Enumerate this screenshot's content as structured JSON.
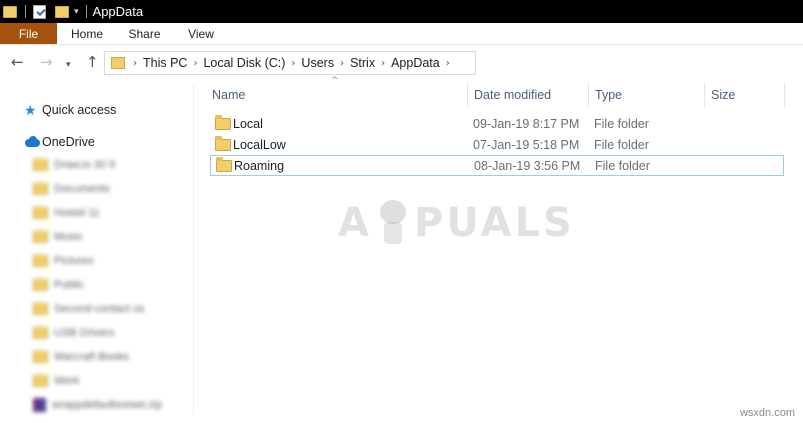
{
  "window": {
    "title": "AppData"
  },
  "ribbon": {
    "tabs": [
      "File",
      "Home",
      "Share",
      "View"
    ]
  },
  "address_bar": {
    "crumbs": [
      "This PC",
      "Local Disk (C:)",
      "Users",
      "Strix",
      "AppData"
    ]
  },
  "nav_pane": {
    "quick_access": "Quick access",
    "onedrive": "OneDrive",
    "items": [
      "Draw.io 30 9",
      "Documents",
      "Hostel 11",
      "Music",
      "Pictures",
      "Public",
      "Second contact us",
      "USB Drivers",
      "Warcraft Books",
      "Work",
      "wrappdefaultsreset.zip"
    ]
  },
  "file_list": {
    "columns": [
      "Name",
      "Date modified",
      "Type",
      "Size"
    ],
    "rows": [
      {
        "name": "Local",
        "date": "09-Jan-19 8:17 PM",
        "type": "File folder",
        "size": ""
      },
      {
        "name": "LocalLow",
        "date": "07-Jan-19 5:18 PM",
        "type": "File folder",
        "size": ""
      },
      {
        "name": "Roaming",
        "date": "08-Jan-19 3:56 PM",
        "type": "File folder",
        "size": ""
      }
    ],
    "selected_row": 2
  },
  "watermark": {
    "left": "A",
    "right": "PUALS"
  },
  "footer_mark": "wsxdn.com",
  "colors": {
    "file_tab": "#a5520e",
    "titlebar": "#000000",
    "selection_border": "#9fcbe8",
    "folder": "#f2cf6b"
  }
}
